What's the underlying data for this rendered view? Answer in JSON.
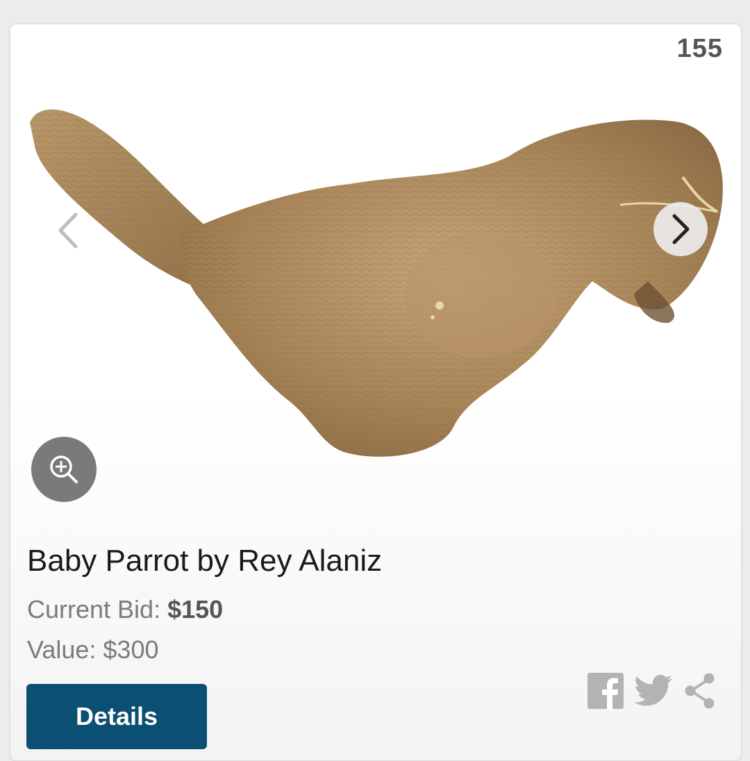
{
  "lot": {
    "number": "155"
  },
  "item": {
    "title": "Baby Parrot by Rey Alaniz",
    "current_bid_label": "Current Bid: ",
    "current_bid_amount": "$150",
    "value_text": "Value: $300",
    "image_subject": "wooden-parrot-sculpture"
  },
  "actions": {
    "details_label": "Details",
    "share_icons": [
      "facebook-icon",
      "twitter-icon",
      "share-icon"
    ]
  },
  "colors": {
    "primary_button": "#0b4f72",
    "zoom_button": "#7a7a7a",
    "social_icons": "#b3b3b3"
  }
}
